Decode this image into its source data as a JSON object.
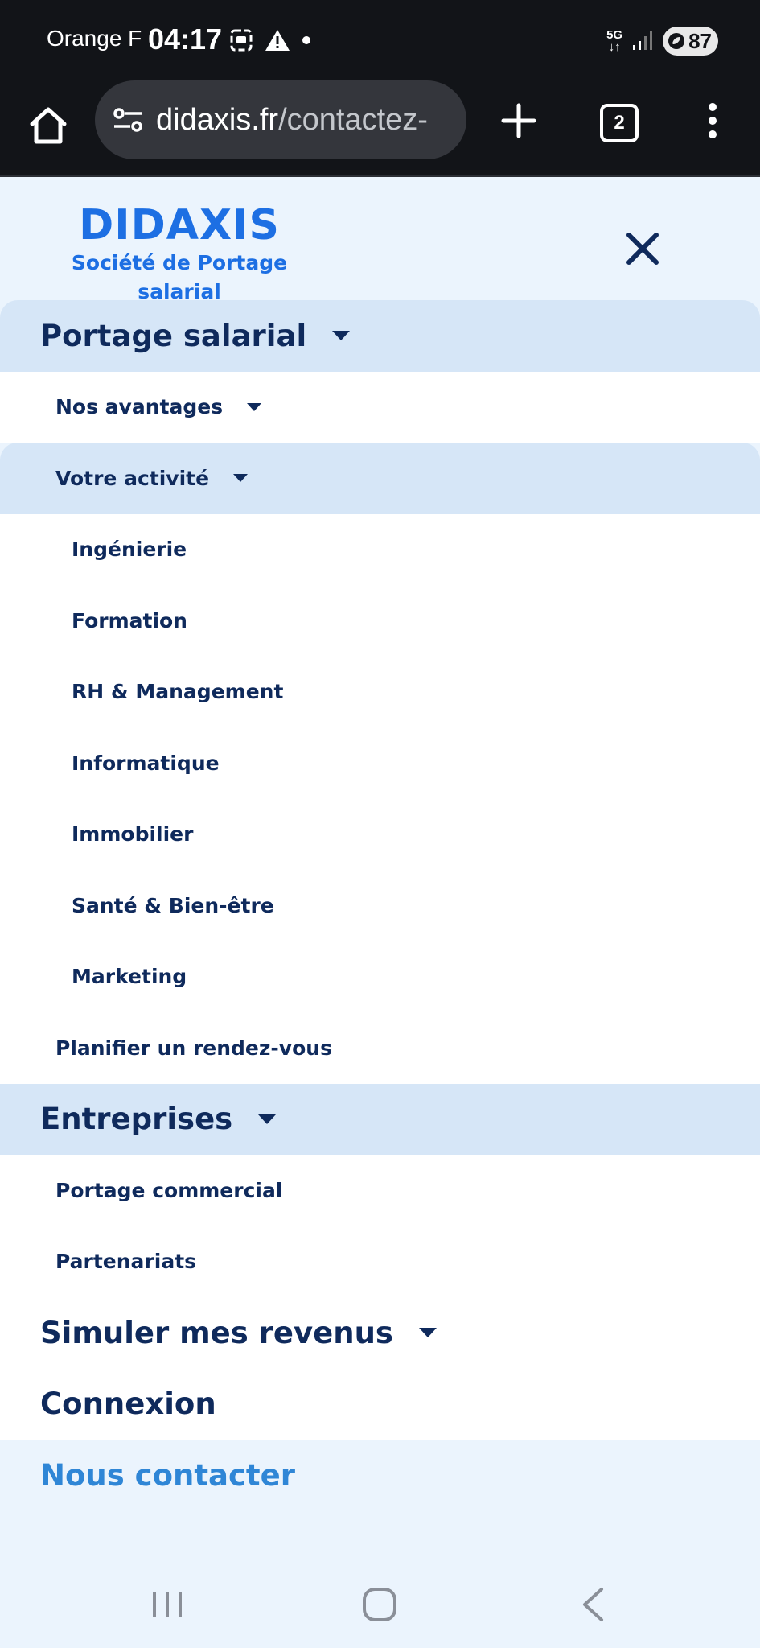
{
  "status_bar": {
    "carrier": "Orange F",
    "time": "04:17",
    "network": "5G",
    "battery": "87",
    "icons": [
      "screenshot-icon",
      "warning-icon",
      "dot-icon",
      "signal-icon",
      "battery-icon"
    ]
  },
  "browser": {
    "url_host": "didaxis.fr",
    "url_path": "/contactez-",
    "tab_count": "2",
    "icons": [
      "home-icon",
      "site-settings-icon",
      "new-tab-icon",
      "tabs-icon",
      "more-icon"
    ]
  },
  "header": {
    "logo_text": "DIDAXIS",
    "tagline_line1": "Société de Portage",
    "tagline_line2": "salarial",
    "close_icon": "close-icon"
  },
  "menu": {
    "portage": {
      "label": "Portage salarial",
      "avantages": "Nos avantages",
      "activite": {
        "label": "Votre activité",
        "items": [
          "Ingénierie",
          "Formation",
          "RH & Management",
          "Informatique",
          "Immobilier",
          "Santé & Bien-être",
          "Marketing"
        ]
      },
      "rdv": "Planifier un rendez-vous"
    },
    "entreprises": {
      "label": "Entreprises",
      "items": [
        "Portage commercial",
        "Partenariats"
      ]
    },
    "simuler": "Simuler mes revenus",
    "connexion": "Connexion",
    "contact": "Nous contacter"
  },
  "colors": {
    "brand": "#1d6fe3",
    "nav_text": "#0f2a5c",
    "highlight": "#d6e6f7",
    "contact": "#2f86d6",
    "page_bg": "#ebf4fd"
  }
}
